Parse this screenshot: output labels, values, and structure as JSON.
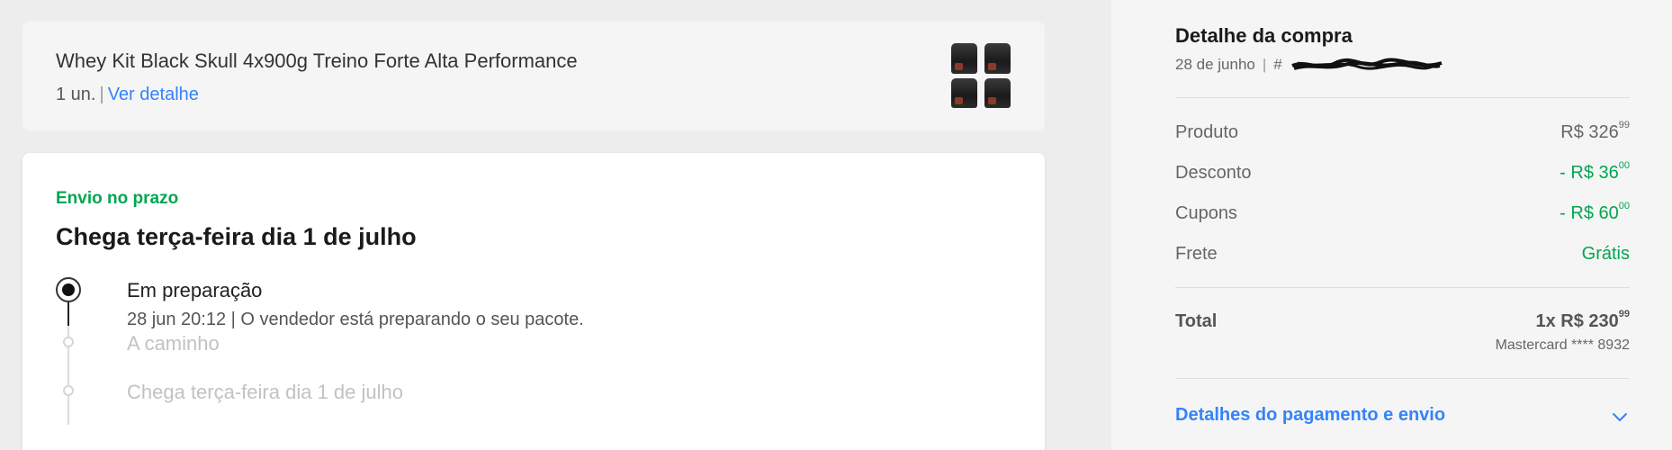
{
  "product": {
    "title": "Whey Kit Black Skull 4x900g Treino Forte Alta Performance",
    "quantity": "1 un.",
    "separator": "|",
    "detail_link": "Ver detalhe"
  },
  "shipping": {
    "status": "Envio no prazo",
    "title": "Chega terça-feira dia 1 de julho",
    "steps": [
      {
        "label": "Em preparação",
        "detail": "28 jun 20:12 | O vendedor está preparando o seu pacote."
      },
      {
        "label": "A caminho"
      },
      {
        "label": "Chega terça-feira dia 1 de julho"
      }
    ]
  },
  "summary": {
    "title": "Detalhe da compra",
    "date": "28 de junho",
    "separator": "|",
    "order_prefix": "#",
    "rows": [
      {
        "label": "Produto",
        "value": "R$ 326",
        "cents": "99",
        "color": "#666666"
      },
      {
        "label": "Desconto",
        "value": "- R$ 36",
        "cents": "00",
        "color": "#00a650"
      },
      {
        "label": "Cupons",
        "value": "- R$ 60",
        "cents": "00",
        "color": "#00a650"
      },
      {
        "label": "Frete",
        "value": "Grátis",
        "cents": "",
        "color": "#00a650"
      }
    ],
    "total_label": "Total",
    "total_value": "1x R$ 230",
    "total_cents": "99",
    "card": "Mastercard **** 8932",
    "payment_link": "Detalhes do pagamento e envio"
  },
  "colors": {
    "accent": "#3483fa",
    "success": "#00a650",
    "background": "#ededed",
    "panel": "#f5f5f5"
  },
  "icons": {
    "expand": "chevron-down-icon",
    "timeline_active": "timeline-active-dot-icon",
    "timeline_pending": "timeline-pending-dot-icon"
  }
}
